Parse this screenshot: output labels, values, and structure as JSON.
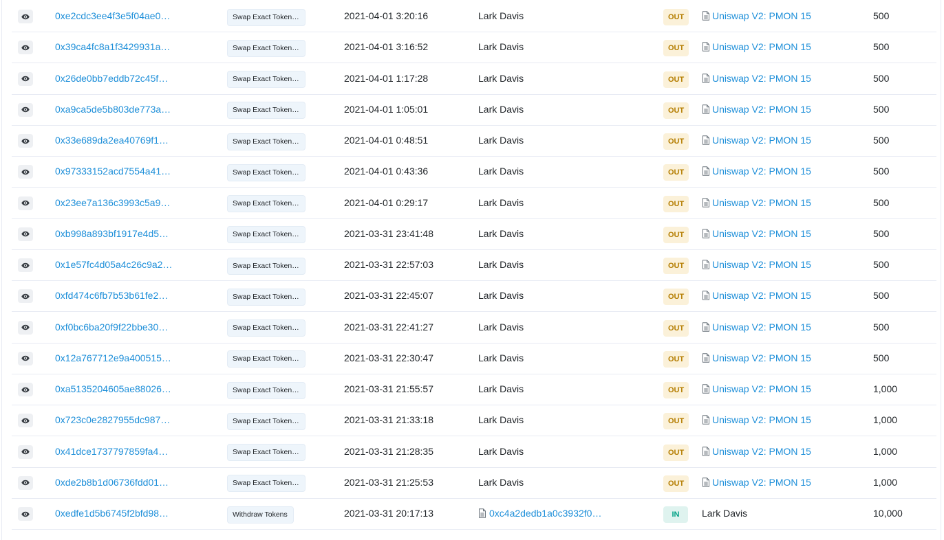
{
  "transactions": [
    {
      "hash": "0xe2cdc3ee4f3e5f04ae0…",
      "method": "Swap Exact Token…",
      "age": "2021-04-01 3:20:16",
      "from": "Lark Davis",
      "from_is_contract": false,
      "direction": "OUT",
      "to": "Uniswap V2: PMON 15",
      "to_is_contract": true,
      "quantity": "500"
    },
    {
      "hash": "0x39ca4fc8a1f3429931a…",
      "method": "Swap Exact Token…",
      "age": "2021-04-01 3:16:52",
      "from": "Lark Davis",
      "from_is_contract": false,
      "direction": "OUT",
      "to": "Uniswap V2: PMON 15",
      "to_is_contract": true,
      "quantity": "500"
    },
    {
      "hash": "0x26de0bb7eddb72c45f…",
      "method": "Swap Exact Token…",
      "age": "2021-04-01 1:17:28",
      "from": "Lark Davis",
      "from_is_contract": false,
      "direction": "OUT",
      "to": "Uniswap V2: PMON 15",
      "to_is_contract": true,
      "quantity": "500"
    },
    {
      "hash": "0xa9ca5de5b803de773a…",
      "method": "Swap Exact Token…",
      "age": "2021-04-01 1:05:01",
      "from": "Lark Davis",
      "from_is_contract": false,
      "direction": "OUT",
      "to": "Uniswap V2: PMON 15",
      "to_is_contract": true,
      "quantity": "500"
    },
    {
      "hash": "0x33e689da2ea40769f1…",
      "method": "Swap Exact Token…",
      "age": "2021-04-01 0:48:51",
      "from": "Lark Davis",
      "from_is_contract": false,
      "direction": "OUT",
      "to": "Uniswap V2: PMON 15",
      "to_is_contract": true,
      "quantity": "500"
    },
    {
      "hash": "0x97333152acd7554a41…",
      "method": "Swap Exact Token…",
      "age": "2021-04-01 0:43:36",
      "from": "Lark Davis",
      "from_is_contract": false,
      "direction": "OUT",
      "to": "Uniswap V2: PMON 15",
      "to_is_contract": true,
      "quantity": "500"
    },
    {
      "hash": "0x23ee7a136c3993c5a9…",
      "method": "Swap Exact Token…",
      "age": "2021-04-01 0:29:17",
      "from": "Lark Davis",
      "from_is_contract": false,
      "direction": "OUT",
      "to": "Uniswap V2: PMON 15",
      "to_is_contract": true,
      "quantity": "500"
    },
    {
      "hash": "0xb998a893bf1917e4d5…",
      "method": "Swap Exact Token…",
      "age": "2021-03-31 23:41:48",
      "from": "Lark Davis",
      "from_is_contract": false,
      "direction": "OUT",
      "to": "Uniswap V2: PMON 15",
      "to_is_contract": true,
      "quantity": "500"
    },
    {
      "hash": "0x1e57fc4d05a4c26c9a2…",
      "method": "Swap Exact Token…",
      "age": "2021-03-31 22:57:03",
      "from": "Lark Davis",
      "from_is_contract": false,
      "direction": "OUT",
      "to": "Uniswap V2: PMON 15",
      "to_is_contract": true,
      "quantity": "500"
    },
    {
      "hash": "0xfd474c6fb7b53b61fe2…",
      "method": "Swap Exact Token…",
      "age": "2021-03-31 22:45:07",
      "from": "Lark Davis",
      "from_is_contract": false,
      "direction": "OUT",
      "to": "Uniswap V2: PMON 15",
      "to_is_contract": true,
      "quantity": "500"
    },
    {
      "hash": "0xf0bc6ba20f9f22bbe30…",
      "method": "Swap Exact Token…",
      "age": "2021-03-31 22:41:27",
      "from": "Lark Davis",
      "from_is_contract": false,
      "direction": "OUT",
      "to": "Uniswap V2: PMON 15",
      "to_is_contract": true,
      "quantity": "500"
    },
    {
      "hash": "0x12a767712e9a400515…",
      "method": "Swap Exact Token…",
      "age": "2021-03-31 22:30:47",
      "from": "Lark Davis",
      "from_is_contract": false,
      "direction": "OUT",
      "to": "Uniswap V2: PMON 15",
      "to_is_contract": true,
      "quantity": "500"
    },
    {
      "hash": "0xa5135204605ae88026…",
      "method": "Swap Exact Token…",
      "age": "2021-03-31 21:55:57",
      "from": "Lark Davis",
      "from_is_contract": false,
      "direction": "OUT",
      "to": "Uniswap V2: PMON 15",
      "to_is_contract": true,
      "quantity": "1,000"
    },
    {
      "hash": "0x723c0e2827955dc987…",
      "method": "Swap Exact Token…",
      "age": "2021-03-31 21:33:18",
      "from": "Lark Davis",
      "from_is_contract": false,
      "direction": "OUT",
      "to": "Uniswap V2: PMON 15",
      "to_is_contract": true,
      "quantity": "1,000"
    },
    {
      "hash": "0x41dce1737797859fa4…",
      "method": "Swap Exact Token…",
      "age": "2021-03-31 21:28:35",
      "from": "Lark Davis",
      "from_is_contract": false,
      "direction": "OUT",
      "to": "Uniswap V2: PMON 15",
      "to_is_contract": true,
      "quantity": "1,000"
    },
    {
      "hash": "0xde2b8b1d06736fdd01…",
      "method": "Swap Exact Token…",
      "age": "2021-03-31 21:25:53",
      "from": "Lark Davis",
      "from_is_contract": false,
      "direction": "OUT",
      "to": "Uniswap V2: PMON 15",
      "to_is_contract": true,
      "quantity": "1,000"
    },
    {
      "hash": "0xedfe1d5b6745f2bfd98…",
      "method": "Withdraw Tokens",
      "age": "2021-03-31 20:17:13",
      "from": "0xc4a2dedb1a0c3932f0…",
      "from_is_contract": true,
      "direction": "IN",
      "to": "Lark Davis",
      "to_is_contract": false,
      "quantity": "10,000"
    }
  ],
  "icons": {
    "view": "eye-icon",
    "contract": "document-icon"
  },
  "colors": {
    "link": "#1e8fd9",
    "out_badge": "#fbf1d9",
    "in_badge": "#dff3ef",
    "method_badge": "#eef5fb"
  }
}
